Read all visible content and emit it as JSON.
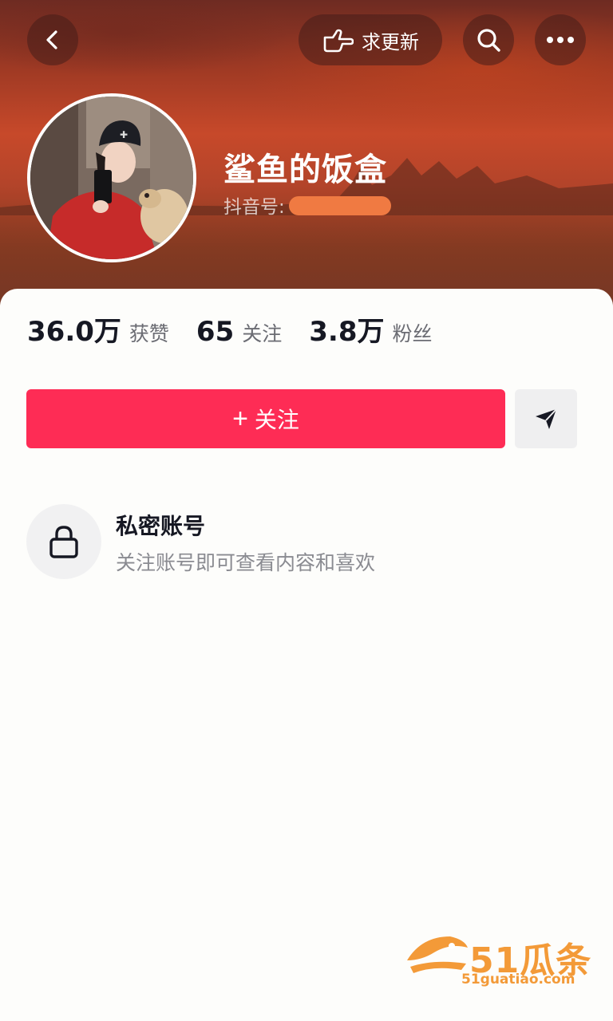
{
  "header": {
    "request_update_label": "求更新",
    "icons": [
      "back-icon",
      "finger-point-icon",
      "search-icon",
      "more-icon"
    ]
  },
  "profile": {
    "nickname": "鲨鱼的饭盒",
    "douyin_id_label": "抖音号:"
  },
  "stats": [
    {
      "value": "36.0万",
      "label": "获赞"
    },
    {
      "value": "65",
      "label": "关注"
    },
    {
      "value": "3.8万",
      "label": "粉丝"
    }
  ],
  "actions": {
    "follow_label": "关注",
    "follow_plus": "+",
    "share_icon": "send-icon"
  },
  "private_notice": {
    "title": "私密账号",
    "description": "关注账号即可查看内容和喜欢",
    "icon": "lock-icon"
  },
  "watermark": {
    "brand": "51瓜条",
    "url": "51guatiao.com"
  },
  "colors": {
    "accent": "#fe2c55",
    "text_primary": "#161823",
    "text_secondary": "#8a8b91",
    "watermark": "#f39a38"
  }
}
